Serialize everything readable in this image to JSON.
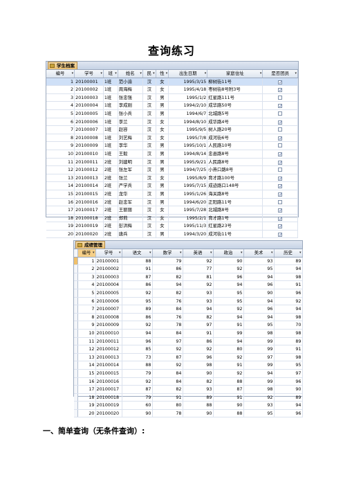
{
  "page": {
    "title": "查询练习",
    "heading": "一、简单查询（无条件查询）:"
  },
  "students": {
    "tab": "学生档案",
    "columns": [
      "编号",
      "学号",
      "班",
      "姓名",
      "民",
      "性",
      "出生日期",
      "家庭住址",
      "是否团员"
    ],
    "rows": [
      {
        "id": "1",
        "sid": "20100001",
        "cls": "1班",
        "name": "范小渝",
        "nation": "汉",
        "sex": "女",
        "birth": "1995/3/15",
        "addr": "柳树街11号",
        "member": true
      },
      {
        "id": "2",
        "sid": "20100002",
        "cls": "1班",
        "name": "周海梅",
        "nation": "汉",
        "sex": "女",
        "birth": "1995/4/18",
        "addr": "枣树街8号附3号",
        "member": true
      },
      {
        "id": "3",
        "sid": "20100003",
        "cls": "1班",
        "name": "张忠强",
        "nation": "汉",
        "sex": "男",
        "birth": "1995/1/2",
        "addr": "红星路111号",
        "member": false
      },
      {
        "id": "4",
        "sid": "20100004",
        "cls": "1班",
        "name": "李成刚",
        "nation": "汉",
        "sex": "男",
        "birth": "1994/2/10",
        "addr": "成华路50号",
        "member": true
      },
      {
        "id": "5",
        "sid": "20100005",
        "cls": "1班",
        "name": "张小兵",
        "nation": "汉",
        "sex": "男",
        "birth": "1994/6/7",
        "addr": "北城路5号",
        "member": false
      },
      {
        "id": "6",
        "sid": "20100006",
        "cls": "1班",
        "name": "李兰",
        "nation": "汉",
        "sex": "女",
        "birth": "1994/8/10",
        "addr": "成华路4号",
        "member": true
      },
      {
        "id": "7",
        "sid": "20100007",
        "cls": "1班",
        "name": "赵容",
        "nation": "汉",
        "sex": "女",
        "birth": "1995/9/5",
        "addr": "树人路20号",
        "member": false
      },
      {
        "id": "8",
        "sid": "20100008",
        "cls": "1班",
        "name": "刘艺梅",
        "nation": "汉",
        "sex": "女",
        "birth": "1995/7/8",
        "addr": "成河街6号",
        "member": true
      },
      {
        "id": "9",
        "sid": "20100009",
        "cls": "1班",
        "name": "李华",
        "nation": "汉",
        "sex": "男",
        "birth": "1995/10/1",
        "addr": "人民路10号",
        "member": false
      },
      {
        "id": "10",
        "sid": "20100010",
        "cls": "1班",
        "name": "王毅",
        "nation": "汉",
        "sex": "男",
        "birth": "1994/8/14",
        "addr": "忠县路8号",
        "member": true
      },
      {
        "id": "11",
        "sid": "20100011",
        "cls": "2班",
        "name": "刘建明",
        "nation": "汉",
        "sex": "男",
        "birth": "1995/9/21",
        "addr": "人民路8号",
        "member": true
      },
      {
        "id": "12",
        "sid": "20100012",
        "cls": "2班",
        "name": "张左军",
        "nation": "汉",
        "sex": "男",
        "birth": "1994/7/25",
        "addr": "小燕口路8号",
        "member": false
      },
      {
        "id": "13",
        "sid": "20100013",
        "cls": "2班",
        "name": "张兰",
        "nation": "汉",
        "sex": "女",
        "birth": "1995/8/9",
        "addr": "育才路100号",
        "member": true
      },
      {
        "id": "14",
        "sid": "20100014",
        "cls": "2班",
        "name": "严学兵",
        "nation": "汉",
        "sex": "男",
        "birth": "1995/7/15",
        "addr": "成迹路口148号",
        "member": true
      },
      {
        "id": "15",
        "sid": "20100015",
        "cls": "2班",
        "name": "龙华",
        "nation": "汉",
        "sex": "男",
        "birth": "1995/1/26",
        "addr": "海关路8号",
        "member": true
      },
      {
        "id": "16",
        "sid": "20100016",
        "cls": "2班",
        "name": "赵忠军",
        "nation": "汉",
        "sex": "男",
        "birth": "1994/6/20",
        "addr": "正阳路11号",
        "member": false
      },
      {
        "id": "17",
        "sid": "20100017",
        "cls": "2班",
        "name": "王丽丽",
        "nation": "汉",
        "sex": "女",
        "birth": "1995/7/28",
        "addr": "北城路8号",
        "member": true
      },
      {
        "id": "18",
        "sid": "20100018",
        "cls": "2班",
        "name": "郑莉",
        "nation": "汉",
        "sex": "女",
        "birth": "1995/2/1",
        "addr": "育才路1号",
        "member": true
      },
      {
        "id": "19",
        "sid": "20100019",
        "cls": "2班",
        "name": "彭洪梅",
        "nation": "汉",
        "sex": "女",
        "birth": "1995/11/3",
        "addr": "红星路23号",
        "member": true
      },
      {
        "id": "20",
        "sid": "20100020",
        "cls": "2班",
        "name": "唐兵",
        "nation": "汉",
        "sex": "男",
        "birth": "1994/3/20",
        "addr": "成河街11号",
        "member": true
      }
    ]
  },
  "grades": {
    "tab": "成绩管理",
    "columns": [
      "编号",
      "学号",
      "语文",
      "数学",
      "英语",
      "政治",
      "美术",
      "历史"
    ],
    "rows": [
      [
        "1",
        "20100001",
        "88",
        "79",
        "92",
        "90",
        "93",
        "89"
      ],
      [
        "2",
        "20100002",
        "91",
        "86",
        "77",
        "92",
        "95",
        "94"
      ],
      [
        "3",
        "20100003",
        "87",
        "82",
        "81",
        "96",
        "94",
        "98"
      ],
      [
        "4",
        "20100004",
        "86",
        "94",
        "92",
        "94",
        "96",
        "91"
      ],
      [
        "5",
        "20100005",
        "92",
        "82",
        "93",
        "95",
        "90",
        "96"
      ],
      [
        "6",
        "20100006",
        "95",
        "76",
        "93",
        "95",
        "94",
        "92"
      ],
      [
        "7",
        "20100007",
        "89",
        "84",
        "94",
        "92",
        "96",
        "94"
      ],
      [
        "8",
        "20100008",
        "86",
        "76",
        "82",
        "94",
        "94",
        "98"
      ],
      [
        "9",
        "20100009",
        "92",
        "78",
        "97",
        "91",
        "95",
        "70"
      ],
      [
        "10",
        "20100010",
        "94",
        "84",
        "91",
        "99",
        "98",
        "98"
      ],
      [
        "11",
        "20100011",
        "96",
        "97",
        "86",
        "94",
        "99",
        "89"
      ],
      [
        "12",
        "20100012",
        "85",
        "92",
        "92",
        "80",
        "99",
        "91"
      ],
      [
        "13",
        "20100013",
        "73",
        "87",
        "96",
        "92",
        "97",
        "98"
      ],
      [
        "14",
        "20100014",
        "88",
        "92",
        "98",
        "91",
        "99",
        "95"
      ],
      [
        "15",
        "20100015",
        "79",
        "84",
        "90",
        "92",
        "94",
        "97"
      ],
      [
        "16",
        "20100016",
        "92",
        "84",
        "82",
        "88",
        "99",
        "96"
      ],
      [
        "17",
        "20100017",
        "87",
        "82",
        "93",
        "87",
        "98",
        "90"
      ],
      [
        "18",
        "20100018",
        "79",
        "91",
        "89",
        "91",
        "92",
        "89"
      ],
      [
        "19",
        "20100019",
        "60",
        "80",
        "88",
        "90",
        "93",
        "94"
      ],
      [
        "20",
        "20100020",
        "90",
        "78",
        "90",
        "88",
        "95",
        "96"
      ]
    ]
  }
}
